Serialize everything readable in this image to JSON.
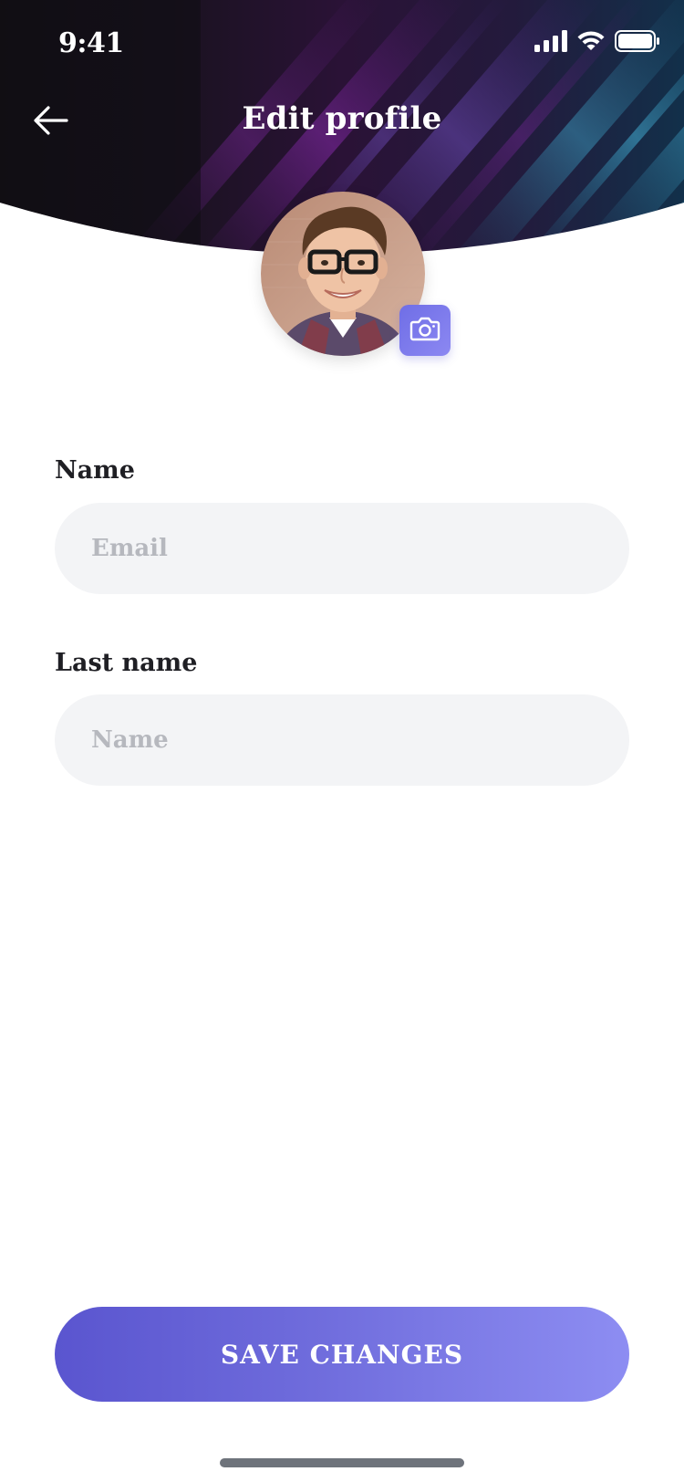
{
  "status_bar": {
    "time": "9:41",
    "icons": [
      "cellular-signal-icon",
      "wifi-icon",
      "battery-icon"
    ]
  },
  "header": {
    "title": "Edit profile",
    "back_icon": "arrow-left-icon"
  },
  "avatar": {
    "camera_icon": "camera-icon"
  },
  "form": {
    "name_label": "Name",
    "name_placeholder": "Email",
    "last_name_label": "Last name",
    "last_name_placeholder": "Name"
  },
  "actions": {
    "save_label": "SAVE CHANGES"
  },
  "colors": {
    "accent_start": "#5a55cf",
    "accent_end": "#8d8df2",
    "input_bg": "#f3f4f6",
    "placeholder": "#b6b8be",
    "label": "#1f1f24"
  }
}
